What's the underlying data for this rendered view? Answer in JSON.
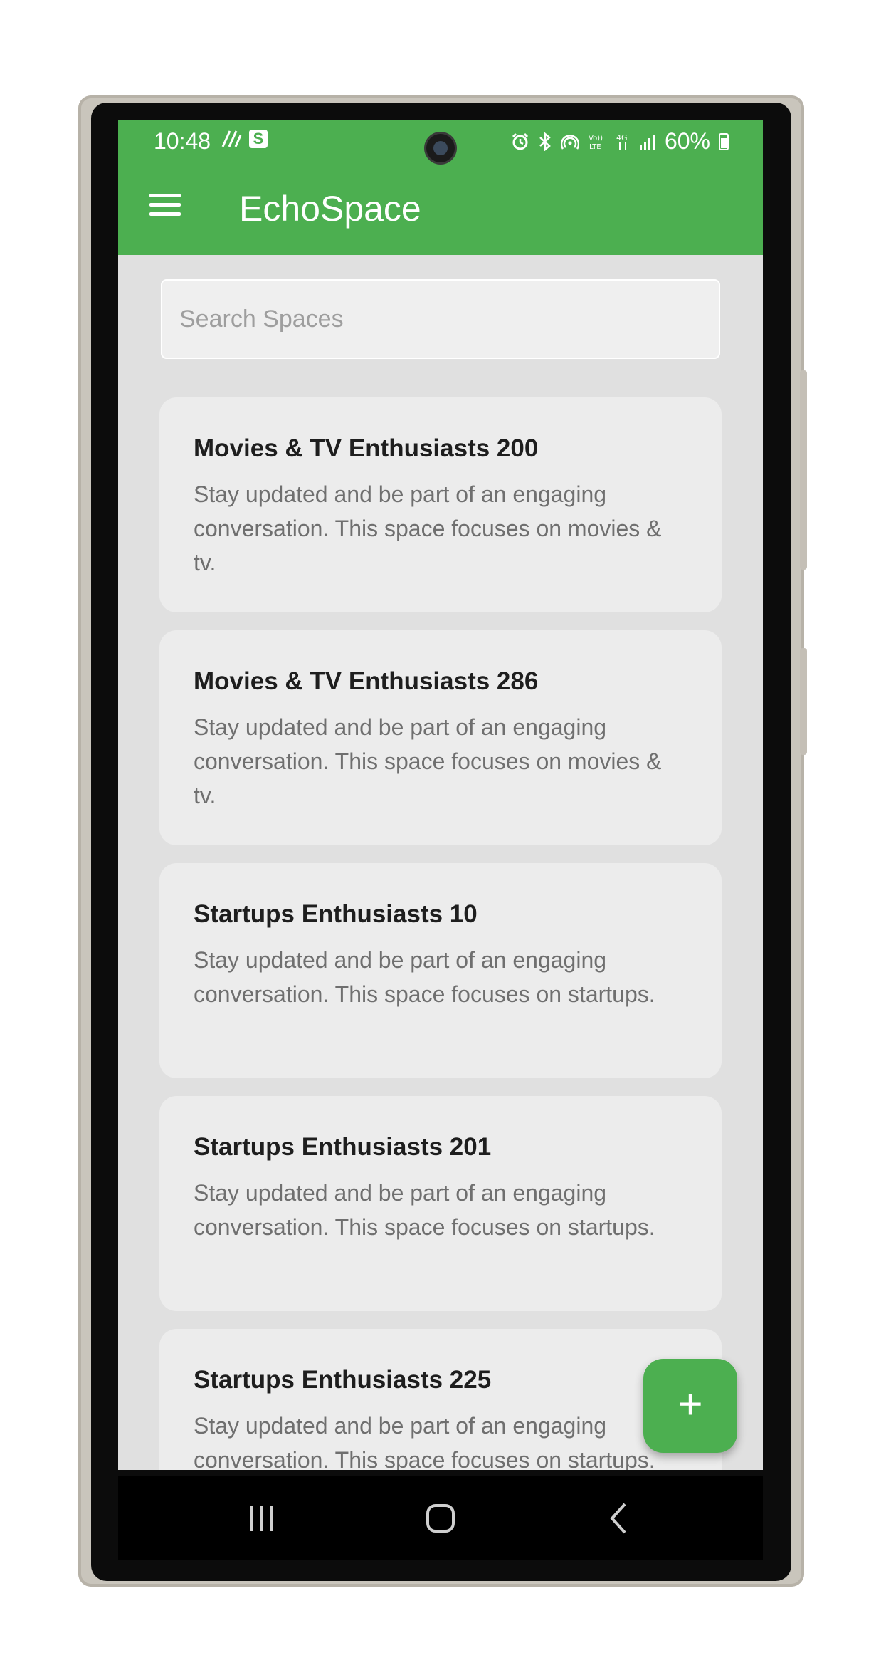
{
  "status_bar": {
    "time": "10:48",
    "battery": "60%",
    "left_icons": [
      "no-sim-icon",
      "s-badge-icon"
    ],
    "right_icons": [
      "alarm-icon",
      "bluetooth-icon",
      "hotspot-icon",
      "volte-icon",
      "4g-icon",
      "signal-icon",
      "battery-icon"
    ],
    "s_badge": "S"
  },
  "app_bar": {
    "title": "EchoSpace",
    "color": "#4caf50",
    "menu_icon": "menu-icon"
  },
  "search": {
    "placeholder": "Search Spaces",
    "value": ""
  },
  "spaces": [
    {
      "title": "Movies & TV Enthusiasts 200",
      "description": "Stay updated and be part of an engaging conversation. This space focuses on movies & tv."
    },
    {
      "title": "Movies & TV Enthusiasts 286",
      "description": "Stay updated and be part of an engaging conversation. This space focuses on movies & tv."
    },
    {
      "title": "Startups Enthusiasts 10",
      "description": "Stay updated and be part of an engaging conversation. This space focuses on startups."
    },
    {
      "title": "Startups Enthusiasts 201",
      "description": "Stay updated and be part of an engaging conversation. This space focuses on startups."
    },
    {
      "title": "Startups Enthusiasts 225",
      "description": "Stay updated and be part of an engaging conversation. This space focuses on startups."
    }
  ],
  "fab": {
    "label": "+",
    "icon": "add-icon"
  },
  "nav_bar": {
    "buttons": [
      "recents-icon",
      "home-icon",
      "back-icon"
    ]
  }
}
